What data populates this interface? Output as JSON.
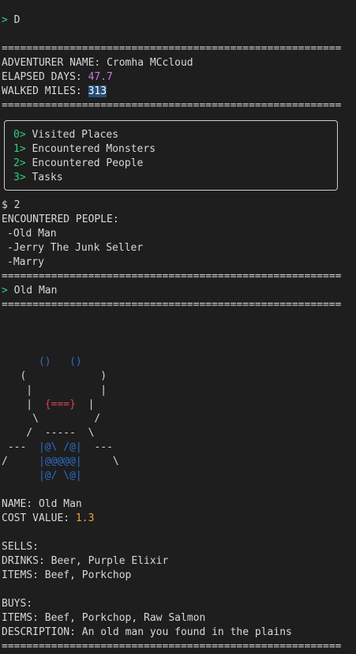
{
  "prompt": ">",
  "command1": "D",
  "separator": "=======================================================",
  "adventurer": {
    "name_label": "ADVENTURER NAME:",
    "name_value": "Cromha MCcloud",
    "days_label": "ELAPSED DAYS:",
    "days_value": "47.7",
    "miles_label": "WALKED MILES:",
    "miles_value": "313"
  },
  "menu": [
    {
      "key": "0>",
      "label": "Visited Places"
    },
    {
      "key": "1>",
      "label": "Encountered Monsters"
    },
    {
      "key": "2>",
      "label": "Encountered People"
    },
    {
      "key": "3>",
      "label": "Tasks"
    }
  ],
  "shell_prompt": "$ 2",
  "people": {
    "heading": "ENCOUNTERED PEOPLE:",
    "items": [
      "-Old Man",
      "-Jerry The Junk Seller",
      "-Marry"
    ]
  },
  "selected_person": "Old Man",
  "ascii_art": {
    "row1": "      ()   ()",
    "row2a": "   (",
    "row2b": "            )",
    "row3": "    |           |",
    "row4a": "    |  ",
    "row4b": "{===}",
    "row4c": "  |",
    "row5": "     \\         /",
    "row6": "    /  -----  \\",
    "row7a": " ---  ",
    "row7b": "|@\\ /@|",
    "row7c": "  ---",
    "row8a": "/     ",
    "row8b": "|@@@@@|",
    "row8c": "     \\",
    "row9": "      |@/ \\@|"
  },
  "details": {
    "name_label": "NAME:",
    "name_value": "Old Man",
    "cost_label": "COST VALUE:",
    "cost_value": "1.3",
    "sells_label": "SELLS:",
    "drinks_label": "DRINKS:",
    "drinks_value": "Beer, Purple Elixir",
    "items_label": "ITEMS:",
    "items_value": "Beef, Porkchop",
    "buys_label": "BUYS:",
    "buy_items_label": "ITEMS:",
    "buy_items_value": "Beef, Porkchop, Raw Salmon",
    "desc_label": "DESCRIPTION:",
    "desc_value": "An old man you found in the plains"
  }
}
